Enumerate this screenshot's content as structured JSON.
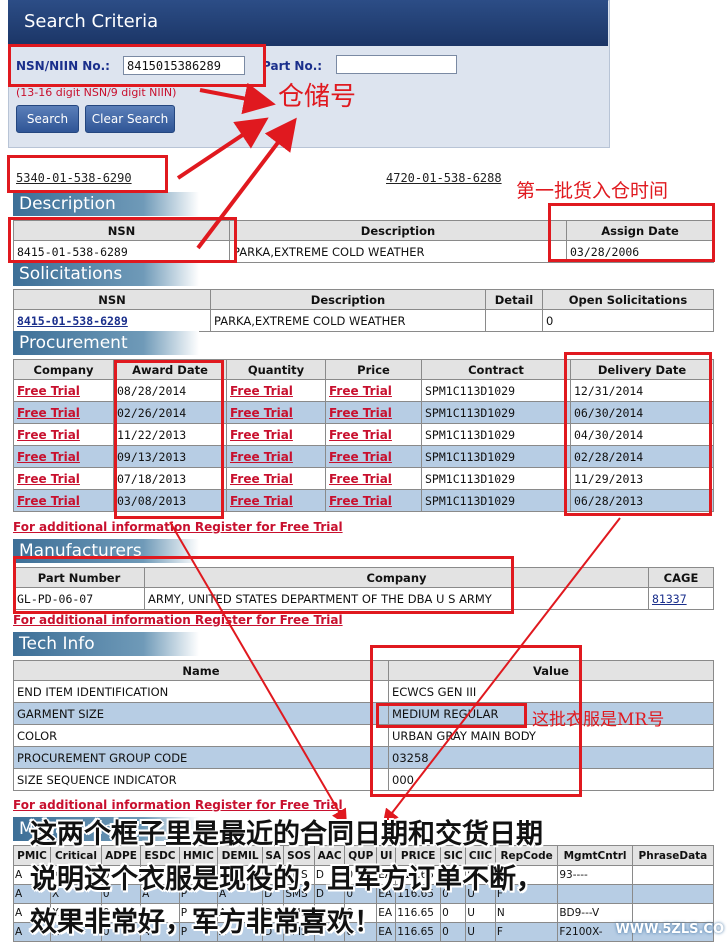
{
  "search": {
    "title": "Search Criteria",
    "nsn_label": "NSN/NIIN No.:",
    "nsn_value": "8415015386289",
    "part_label": "Part No.:",
    "part_value": "",
    "hint": "(13-16 digit NSN/9 digit NIIN)",
    "search_btn": "Search",
    "clear_btn": "Clear Search"
  },
  "links": {
    "left": "5340-01-538-6290",
    "right": "4720-01-538-6288"
  },
  "description": {
    "heading": "Description",
    "headers": [
      "NSN",
      "Description",
      "Assign Date"
    ],
    "row": [
      "8415-01-538-6289",
      "PARKA,EXTREME COLD WEATHER",
      "03/28/2006"
    ]
  },
  "solicitations": {
    "heading": "Solicitations",
    "headers": [
      "NSN",
      "Description",
      "Detail",
      "Open Solicitations"
    ],
    "row": [
      "8415-01-538-6289",
      "PARKA,EXTREME COLD WEATHER",
      "",
      "0"
    ]
  },
  "procurement": {
    "heading": "Procurement",
    "headers": [
      "Company",
      "Award Date",
      "Quantity",
      "Price",
      "Contract",
      "Delivery Date"
    ],
    "rows": [
      [
        "Free Trial",
        "08/28/2014",
        "Free Trial",
        "Free Trial",
        "SPM1C113D1029",
        "12/31/2014"
      ],
      [
        "Free Trial",
        "02/26/2014",
        "Free Trial",
        "Free Trial",
        "SPM1C113D1029",
        "06/30/2014"
      ],
      [
        "Free Trial",
        "11/22/2013",
        "Free Trial",
        "Free Trial",
        "SPM1C113D1029",
        "04/30/2014"
      ],
      [
        "Free Trial",
        "09/13/2013",
        "Free Trial",
        "Free Trial",
        "SPM1C113D1029",
        "02/28/2014"
      ],
      [
        "Free Trial",
        "07/18/2013",
        "Free Trial",
        "Free Trial",
        "SPM1C113D1029",
        "11/29/2013"
      ],
      [
        "Free Trial",
        "03/08/2013",
        "Free Trial",
        "Free Trial",
        "SPM1C113D1029",
        "06/28/2013"
      ]
    ],
    "note": "For additional information Register for Free Trial"
  },
  "manufacturers": {
    "heading": "Manufacturers",
    "headers": [
      "Part Number",
      "Company",
      "CAGE"
    ],
    "row": [
      "GL-PD-06-07",
      "ARMY, UNITED STATES DEPARTMENT OF THE DBA U S ARMY",
      "81337"
    ],
    "note": "For additional information Register for Free Trial"
  },
  "techinfo": {
    "heading": "Tech Info",
    "headers": [
      "Name",
      "Value"
    ],
    "rows": [
      [
        "END ITEM IDENTIFICATION",
        "ECWCS GEN III"
      ],
      [
        "GARMENT SIZE",
        "MEDIUM REGULAR"
      ],
      [
        "COLOR",
        "URBAN GRAY MAIN BODY"
      ],
      [
        "PROCUREMENT GROUP CODE",
        "03258"
      ],
      [
        "SIZE SEQUENCE INDICATOR",
        "000"
      ]
    ],
    "note": "For additional information Register for Free Trial"
  },
  "management": {
    "heading": "Management",
    "headers": [
      "PMIC",
      "Critical",
      "ADPE",
      "ESDC",
      "HMIC",
      "DEMIL",
      "SA",
      "SOS",
      "AAC",
      "QUP",
      "UI",
      "PRICE",
      "SIC",
      "CIIC",
      "RepCode",
      "MgmtCntrl",
      "PhraseData"
    ],
    "rows": [
      [
        "A",
        "X",
        "0",
        "A",
        "P",
        "A",
        "D",
        "SMS",
        "D",
        "0",
        "EA",
        "116.65",
        "0",
        "U",
        "F",
        "93----",
        ""
      ],
      [
        "A",
        "X",
        "0",
        "A",
        "P",
        "A",
        "D",
        "SMS",
        "D",
        "0",
        "EA",
        "116.65",
        "0",
        "U",
        "F",
        "",
        ""
      ],
      [
        "A",
        "X",
        "0",
        "A",
        "P",
        "A",
        "D",
        "SMS",
        "D",
        "0",
        "EA",
        "116.65",
        "0",
        "U",
        "N",
        "BD9---V",
        ""
      ],
      [
        "A",
        "X",
        "0",
        "A",
        "P",
        "A",
        "D",
        "SMS",
        "D",
        "0",
        "EA",
        "116.65",
        "0",
        "U",
        "F",
        "F2100X-",
        ""
      ]
    ]
  },
  "annotations": {
    "warehouse": "仓储号",
    "first_batch": "第一批货入仓时间",
    "mr_size": "这批衣服是MR号",
    "summary_line1": "这两个框子里是最近的合同日期和交货日期",
    "summary_line2": "说明这个衣服是现役的，且军方订单不断，",
    "summary_line3": "效果非常好，军方非常喜欢！",
    "watermark": "WWW.5ZLS.CO"
  }
}
